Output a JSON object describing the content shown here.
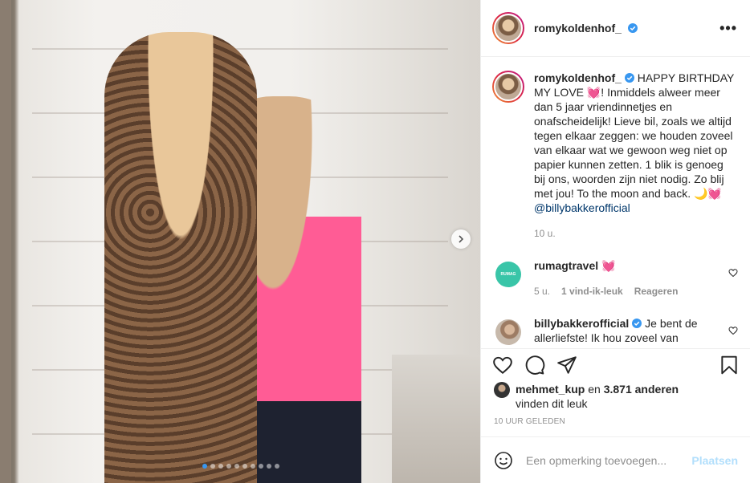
{
  "post": {
    "username": "romykoldenhof_",
    "verified": true,
    "more_icon": "more-horizontal-icon"
  },
  "caption": {
    "username": "romykoldenhof_",
    "text": "HAPPY BIRTHDAY MY LOVE 💓! Inmiddels alweer meer dan 5 jaar vriendinnetjes en onafscheidelijk! Lieve bil, zoals we altijd tegen elkaar zeggen: we houden zoveel van elkaar wat we gewoon weg niet op papier kunnen zetten. 1 blik is genoeg bij ons, woorden zijn niet nodig. Zo blij met jou! To the moon and back. 🌙💓",
    "mention": "@billybakkerofficial",
    "time": "10 u."
  },
  "comments": [
    {
      "username": "rumagtravel",
      "text": "💓",
      "time": "5 u.",
      "likes": "1 vind-ik-leuk",
      "reply": "Reageren",
      "avatar_text": "RUMAG"
    },
    {
      "username": "billybakkerofficial",
      "verified": true,
      "text": "Je bent de allerliefste! Ik hou zoveel van"
    }
  ],
  "likes": {
    "user": "mehmet_kup",
    "connector": "en",
    "others": "3.871 anderen",
    "suffix": "vinden dit leuk"
  },
  "timestamp": "10 UUR GELEDEN",
  "add_comment": {
    "placeholder": "Een opmerking toevoegen...",
    "post_label": "Plaatsen"
  },
  "carousel": {
    "slide_count": 10,
    "active_index": 0
  },
  "colors": {
    "link": "#00376b",
    "verified": "#3897f0",
    "post_button_disabled": "#b2dffc"
  }
}
